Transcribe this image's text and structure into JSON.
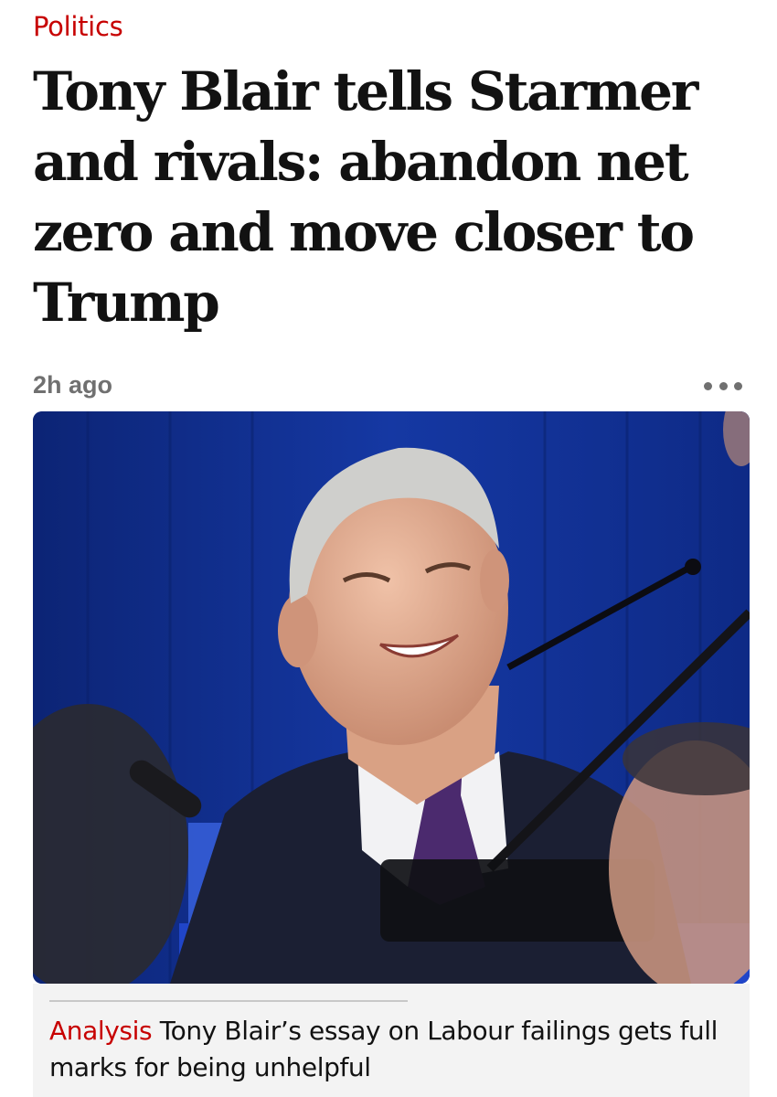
{
  "article": {
    "section": "Politics",
    "headline": "Tony Blair tells Starmer and rivals: abandon net zero and move closer to Trump",
    "timestamp": "2h ago",
    "more_icon": "more-horizontal-icon"
  },
  "related": {
    "kicker": "Analysis",
    "text": "Tony Blair’s essay on Labour failings gets full marks for being unhelpful"
  },
  "colors": {
    "accent": "#c70000",
    "headline": "#121212",
    "meta": "#707070",
    "panel": "#f3f3f3",
    "photo_backdrop": "#0f2b86"
  }
}
